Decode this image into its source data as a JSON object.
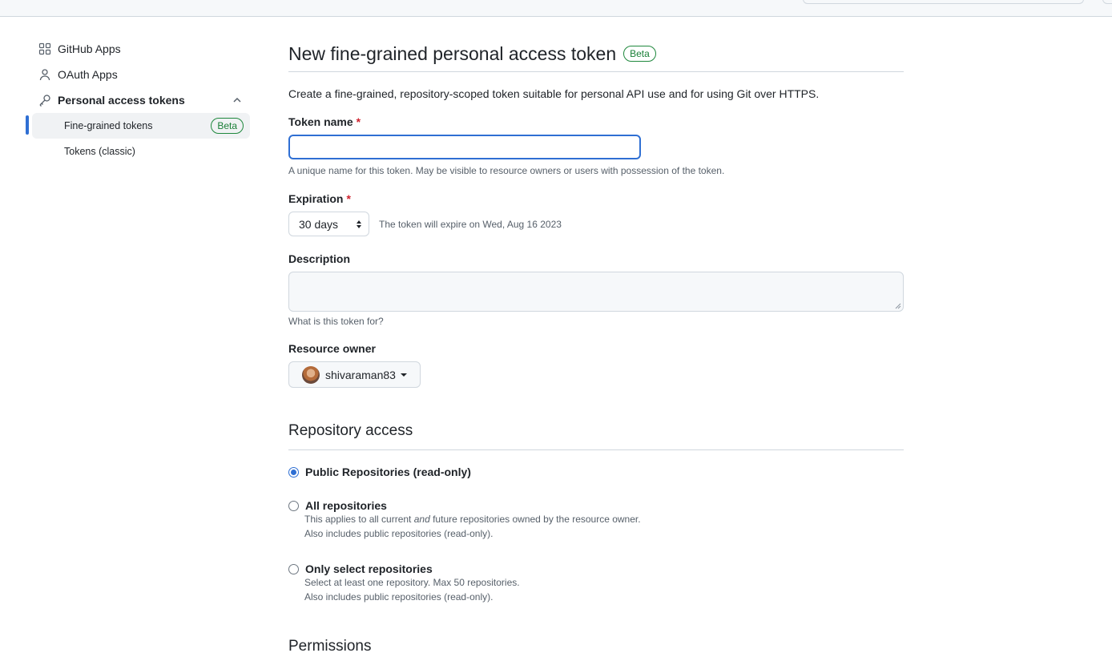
{
  "sidebar": {
    "items": [
      {
        "label": "GitHub Apps",
        "icon": "apps-grid-icon"
      },
      {
        "label": "OAuth Apps",
        "icon": "person-icon"
      },
      {
        "label": "Personal access tokens",
        "icon": "key-icon"
      }
    ],
    "sub_items": [
      {
        "label": "Fine-grained tokens",
        "badge": "Beta",
        "active": true
      },
      {
        "label": "Tokens (classic)"
      }
    ]
  },
  "header": {
    "title": "New fine-grained personal access token",
    "badge": "Beta"
  },
  "intro": "Create a fine-grained, repository-scoped token suitable for personal API use and for using Git over HTTPS.",
  "form": {
    "token_name": {
      "label": "Token name",
      "required_mark": "*",
      "value": "",
      "note": "A unique name for this token. May be visible to resource owners or users with possession of the token."
    },
    "expiration": {
      "label": "Expiration",
      "required_mark": "*",
      "selected": "30 days",
      "note": "The token will expire on Wed, Aug 16 2023"
    },
    "description": {
      "label": "Description",
      "value": "",
      "note": "What is this token for?"
    },
    "resource_owner": {
      "label": "Resource owner",
      "selected": "shivaraman83"
    }
  },
  "repository_access": {
    "title": "Repository access",
    "options": [
      {
        "label": "Public Repositories (read-only)",
        "checked": true
      },
      {
        "label": "All repositories",
        "desc_pre": "This applies to all current ",
        "desc_em": "and",
        "desc_post": " future repositories owned by the resource owner.",
        "desc2": "Also includes public repositories (read-only)."
      },
      {
        "label": "Only select repositories",
        "desc1": "Select at least one repository. Max 50 repositories.",
        "desc2": "Also includes public repositories (read-only)."
      }
    ]
  },
  "permissions": {
    "title": "Permissions"
  },
  "colors": {
    "accent": "#2f6fd3",
    "success": "#1a7f37",
    "danger": "#cf222e",
    "border": "#d0d7de"
  }
}
